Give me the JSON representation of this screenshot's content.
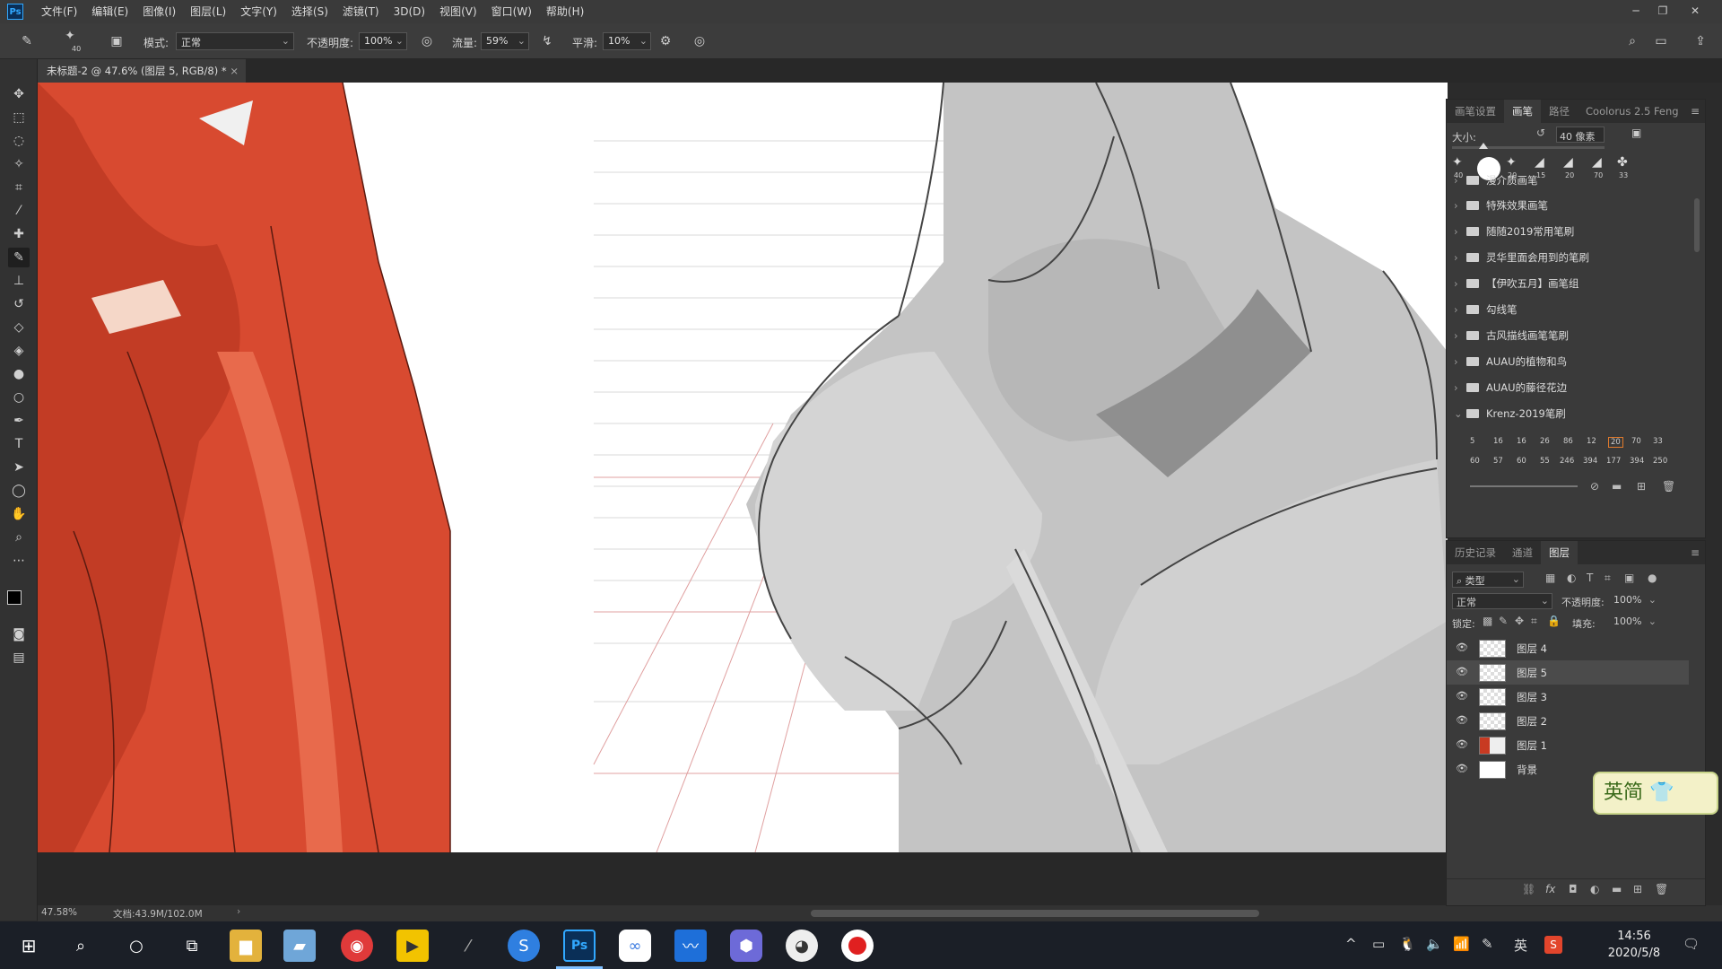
{
  "app": {
    "logo": "Ps"
  },
  "menu": [
    "文件(F)",
    "编辑(E)",
    "图像(I)",
    "图层(L)",
    "文字(Y)",
    "选择(S)",
    "滤镜(T)",
    "3D(D)",
    "视图(V)",
    "窗口(W)",
    "帮助(H)"
  ],
  "options": {
    "brush_size": "40",
    "mode_label": "模式:",
    "mode_value": "正常",
    "opacity_label": "不透明度:",
    "opacity_value": "100%",
    "flow_label": "流量:",
    "flow_value": "59%",
    "smooth_label": "平滑:",
    "smooth_value": "10%"
  },
  "document": {
    "tab_title": "未标题-2 @ 47.6% (图层 5, RGB/8) *"
  },
  "status": {
    "zoom": "47.58%",
    "doc_size": "文档:43.9M/102.0M"
  },
  "brush_panel": {
    "tabs": [
      "画笔设置",
      "画笔",
      "路径",
      "Coolorus 2.5 Feng"
    ],
    "active_tab": "画笔",
    "size_label": "大小:",
    "size_value": "40 像素",
    "presets": [
      "40",
      "20",
      "15",
      "20",
      "70",
      "33"
    ],
    "folders": [
      "漫介质画笔",
      "特殊效果画笔",
      "随随2019常用笔刷",
      "灵华里面会用到的笔刷",
      "【伊吹五月】画笔组",
      "勾线笔",
      "古风描线画笔笔刷",
      "AUAU的植物和鸟",
      "AUAU的藤径花边",
      "Krenz-2019笔刷"
    ],
    "krenz_row1": [
      "5",
      "16",
      "16",
      "26",
      "86",
      "12",
      "20",
      "70",
      "33"
    ],
    "krenz_row2": [
      "60",
      "57",
      "60",
      "55",
      "246",
      "394",
      "177",
      "394",
      "250"
    ]
  },
  "layers_panel": {
    "tabs": [
      "历史记录",
      "通道",
      "图层"
    ],
    "active_tab": "图层",
    "filter_label": "类型",
    "blend_mode": "正常",
    "opacity_label": "不透明度:",
    "opacity_value": "100%",
    "lock_label": "锁定:",
    "fill_label": "填充:",
    "fill_value": "100%",
    "layers": [
      "图层 4",
      "图层 5",
      "图层 3",
      "图层 2",
      "图层 1",
      "背景"
    ],
    "selected_layer": "图层 5"
  },
  "ime_badge": "英简",
  "taskbar": {
    "tray_lang": "英",
    "time": "14:56",
    "date": "2020/5/8"
  }
}
